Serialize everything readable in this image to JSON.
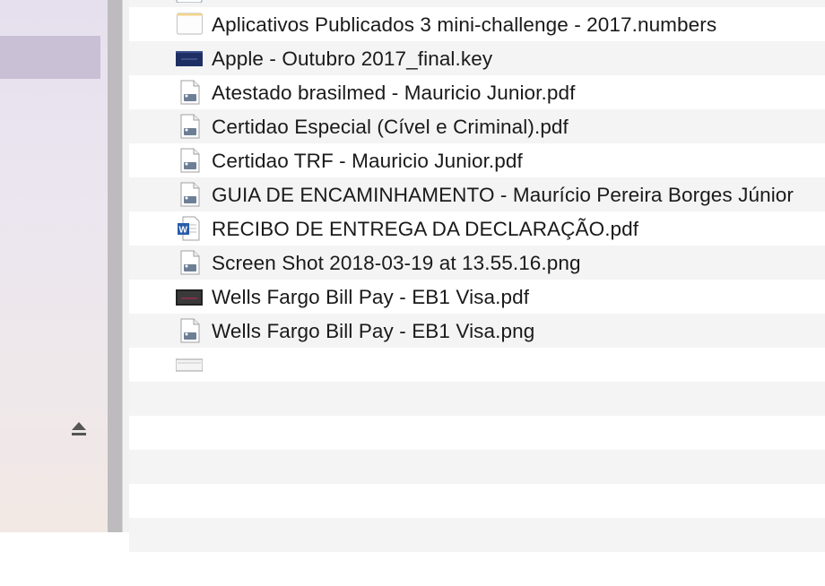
{
  "files": [
    {
      "name": "",
      "icon": "numbers-icon"
    },
    {
      "name": "Aplicativos Publicados 3 mini-challenge - 2017.numbers",
      "icon": "numbers-icon"
    },
    {
      "name": "Apple - Outubro 2017_final.key",
      "icon": "keynote-icon"
    },
    {
      "name": "Atestado brasilmed - Mauricio Junior.pdf",
      "icon": "pdf-icon"
    },
    {
      "name": "Certidao Especial (Cível e Criminal).pdf",
      "icon": "pdf-icon"
    },
    {
      "name": "Certidao TRF - Mauricio Junior.pdf",
      "icon": "pdf-icon"
    },
    {
      "name": "GUIA DE ENCAMINHAMENTO -  Maurício Pereira Borges Júnior",
      "icon": "word-icon"
    },
    {
      "name": "RECIBO DE ENTREGA DA DECLARAÇÃO.pdf",
      "icon": "pdf-icon"
    },
    {
      "name": "Screen Shot 2018-03-19 at 13.55.16.png",
      "icon": "screenshot-icon"
    },
    {
      "name": "Wells Fargo Bill Pay - EB1 Visa.pdf",
      "icon": "pdf-icon"
    },
    {
      "name": "Wells Fargo Bill Pay - EB1 Visa.png",
      "icon": "png-icon"
    }
  ],
  "sidebar": {
    "eject_icon": "eject-icon"
  }
}
